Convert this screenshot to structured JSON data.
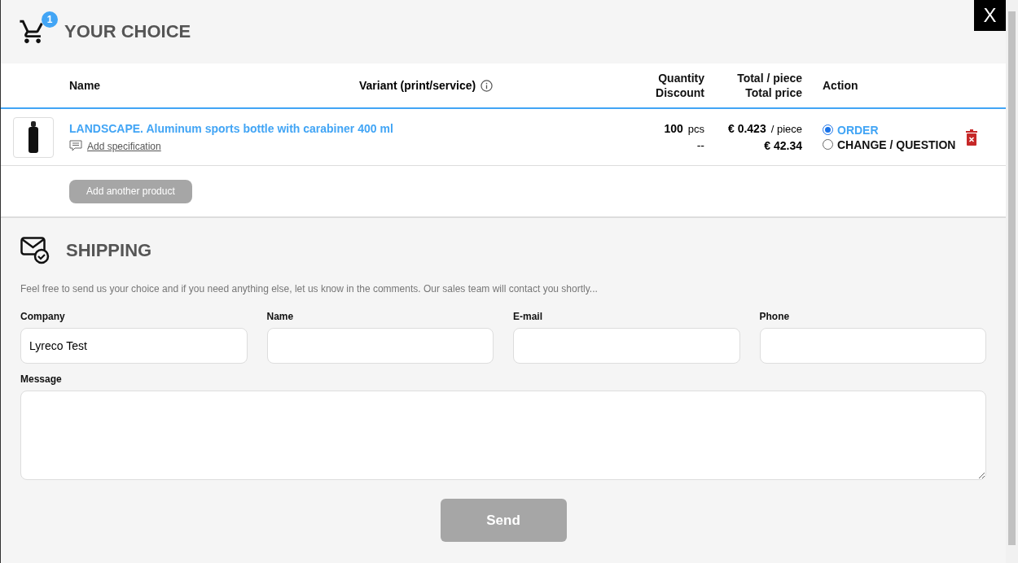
{
  "cart": {
    "badge": "1",
    "title": "YOUR CHOICE"
  },
  "close": "X",
  "table": {
    "columns": {
      "name": "Name",
      "variant": "Variant (print/service)",
      "quantity": [
        "Quantity",
        "Discount"
      ],
      "price": [
        "Total / piece",
        "Total price"
      ],
      "action": "Action"
    },
    "rows": [
      {
        "name": "LANDSCAPE. Aluminum sports bottle with carabiner 400 ml",
        "spec_link": "Add specification",
        "quantity": "100",
        "unit": "pcs",
        "discount": "--",
        "piece_price": "€ 0.423",
        "piece_unit": "/ piece",
        "total": "€ 42.34",
        "actions": [
          {
            "label": "ORDER",
            "selected": true
          },
          {
            "label": "CHANGE / QUESTION",
            "selected": false
          }
        ]
      }
    ],
    "add_button": "Add another product"
  },
  "shipping": {
    "title": "SHIPPING",
    "intro": "Feel free to send us your choice and if you need anything else, let us know in the comments. Our sales team will contact you shortly...",
    "fields": [
      {
        "label": "Company",
        "value": "Lyreco Test"
      },
      {
        "label": "Name"
      },
      {
        "label": "E-mail"
      },
      {
        "label": "Phone"
      }
    ],
    "message": {
      "label": "Message"
    },
    "send": "Send"
  }
}
